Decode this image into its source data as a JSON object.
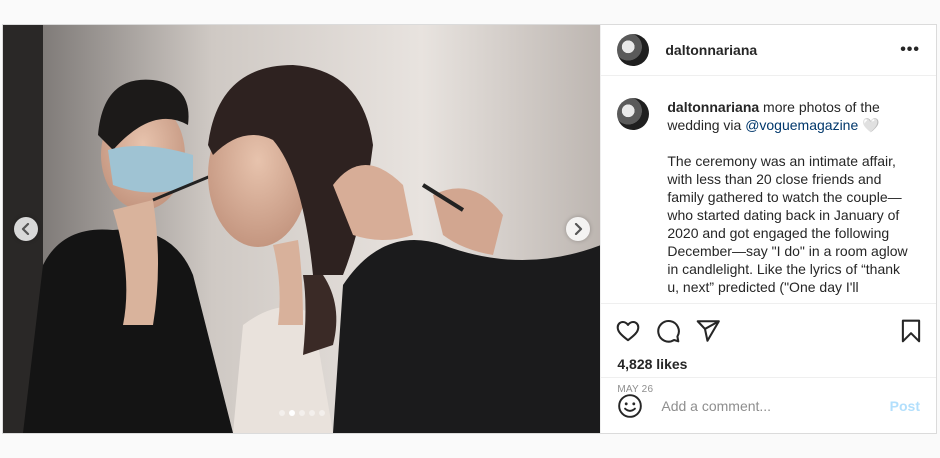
{
  "post": {
    "username": "daltonnariana",
    "more_label": "•••",
    "caption_intro": "more photos of the wedding via",
    "caption_mention": "@voguemagazine",
    "caption_emoji": "🤍",
    "caption_body": "The ceremony was an intimate affair, with less than 20 close friends and family gathered to watch the couple—who started dating back in January of 2020 and got engaged the following December—say \"I do\" in a room aglow in candlelight. Like the lyrics of “thank u, next” predicted (\"One day I'll",
    "likes": "4,828 likes",
    "date": "MAY 26",
    "comment_placeholder": "Add a comment...",
    "post_label": "Post"
  },
  "carousel": {
    "slide_count": 5,
    "active_index": 1
  },
  "icons": {
    "prev": "chevron-left-icon",
    "next": "chevron-right-icon",
    "like": "heart-icon",
    "comment": "comment-bubble-icon",
    "share": "paper-plane-icon",
    "save": "bookmark-icon",
    "emoji": "smiley-icon"
  },
  "colors": {
    "link": "#00376b",
    "post_disabled": "#b2dffc",
    "muted": "#8e8e8e"
  }
}
